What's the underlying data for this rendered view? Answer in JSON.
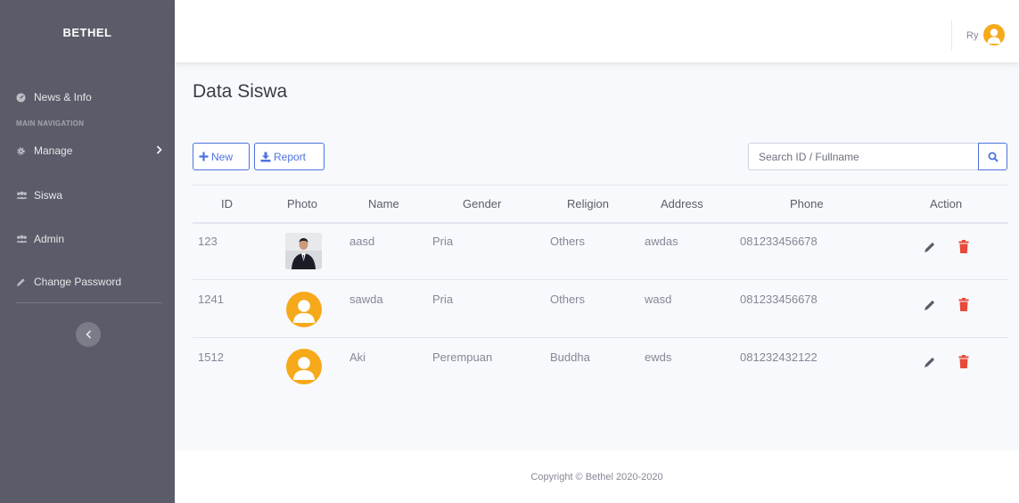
{
  "sidebar": {
    "brand": "BETHEL",
    "heading": "MAIN NAVIGATION",
    "items": [
      {
        "label": "News & Info",
        "icon": "dashboard-icon"
      },
      {
        "label": "Manage",
        "icon": "gear-icon"
      },
      {
        "label": "Siswa",
        "icon": "users-icon"
      },
      {
        "label": "Admin",
        "icon": "users-icon"
      },
      {
        "label": "Change Password",
        "icon": "pen-icon"
      }
    ]
  },
  "topbar": {
    "user_name": "Ry"
  },
  "page": {
    "title": "Data Siswa"
  },
  "toolbar": {
    "new_label": "New",
    "report_label": "Report",
    "search_placeholder": "Search ID / Fullname"
  },
  "table": {
    "headers": [
      "ID",
      "Photo",
      "Name",
      "Gender",
      "Religion",
      "Address",
      "Phone",
      "Action"
    ],
    "rows": [
      {
        "id": "123",
        "photo": "person-photo",
        "name": "aasd",
        "gender": "Pria",
        "religion": "Others",
        "address": "awdas",
        "phone": "081233456678"
      },
      {
        "id": "1241",
        "photo": "default-avatar",
        "name": "sawda",
        "gender": "Pria",
        "religion": "Others",
        "address": "wasd",
        "phone": "081233456678"
      },
      {
        "id": "1512",
        "photo": "default-avatar",
        "name": "Aki",
        "gender": "Perempuan",
        "religion": "Buddha",
        "address": "ewds",
        "phone": "081232432122"
      }
    ]
  },
  "footer": {
    "copyright": "Copyright © Bethel 2020-2020"
  },
  "colors": {
    "sidebar": "#5a5c69",
    "primary": "#4e73df",
    "avatar": "#f6a91a",
    "delete": "#e74a3b",
    "edit": "#5a5c69"
  }
}
